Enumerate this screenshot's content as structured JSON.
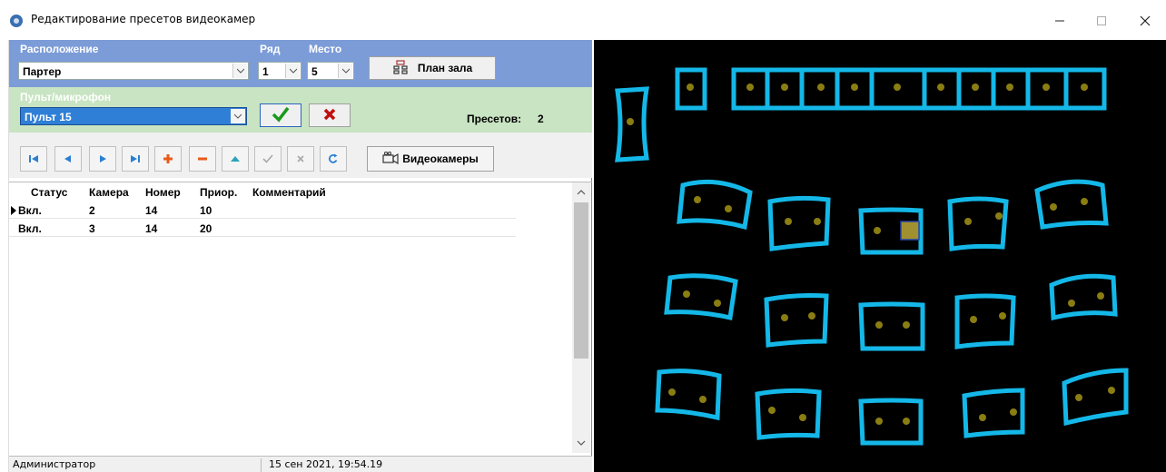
{
  "window": {
    "title": "Редактирование пресетов видеокамер",
    "minimize_icon": "minimize-icon",
    "maximize_icon": "maximize-icon",
    "close_icon": "close-icon"
  },
  "location": {
    "label": "Расположение",
    "value": "Партер",
    "row_label": "Ряд",
    "row_value": "1",
    "seat_label": "Место",
    "seat_value": "5",
    "hall_plan_button": "План зала"
  },
  "microphone": {
    "label": "Пульт/микрофон",
    "value": "Пульт 15",
    "confirm_icon": "check-icon",
    "cancel_icon": "x-icon",
    "presets_label": "Пресетов:",
    "presets_count": "2"
  },
  "toolbar": {
    "nav_icons": [
      "first-icon",
      "prev-icon",
      "next-icon",
      "last-icon",
      "add-icon",
      "remove-icon",
      "up-icon",
      "apply-icon",
      "cancel-icon",
      "refresh-icon"
    ],
    "cameras_button": "Видеокамеры"
  },
  "grid": {
    "columns": [
      "Статус",
      "Камера",
      "Номер",
      "Приор.",
      "Комментарий"
    ],
    "rows": [
      {
        "status": "Вкл.",
        "camera": "2",
        "number": "14",
        "priority": "10",
        "comment": ""
      },
      {
        "status": "Вкл.",
        "camera": "3",
        "number": "14",
        "priority": "20",
        "comment": ""
      }
    ]
  },
  "statusbar": {
    "user": "Администратор",
    "datetime": "15 сен 2021, 19:54.19"
  },
  "colors": {
    "seat_outline": "#14b8e8",
    "seat_dot": "#8a7d12",
    "selected_seat": "#a09030",
    "hall_background": "#000000",
    "location_panel": "#7c9cd8",
    "mic_panel": "#c8e4c2"
  },
  "hall_map": {
    "selected_seat": "Ряд 1, Место 5"
  }
}
